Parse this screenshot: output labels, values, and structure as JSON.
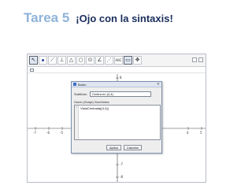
{
  "slide": {
    "title": "Tarea 5",
    "subtitle": "¡Ojo con la sintaxis!"
  },
  "app": {
    "toolbar": {
      "text_tool_label": "ABC"
    },
    "axis_labels": {
      "x_neg": [
        "-7",
        "-6",
        "-5"
      ],
      "x_pos": [
        "4",
        "5"
      ],
      "y_pos": [
        "8",
        "7",
        "6"
      ],
      "y_neg": [
        "-7",
        "-8"
      ]
    }
  },
  "dialog": {
    "title": "Botón",
    "subtitle_label": "Subtítulo:",
    "subtitle_value": "Centra en (4,4)",
    "script_label": "Guión (Script) GeoGebra",
    "script_code": "VistaCentrada[(4,4)]",
    "apply_label": "Aplica",
    "cancel_label": "Cancela"
  },
  "colors": {
    "title_blue": "#8fb3d9",
    "subtitle_navy": "#1a2e5c"
  }
}
